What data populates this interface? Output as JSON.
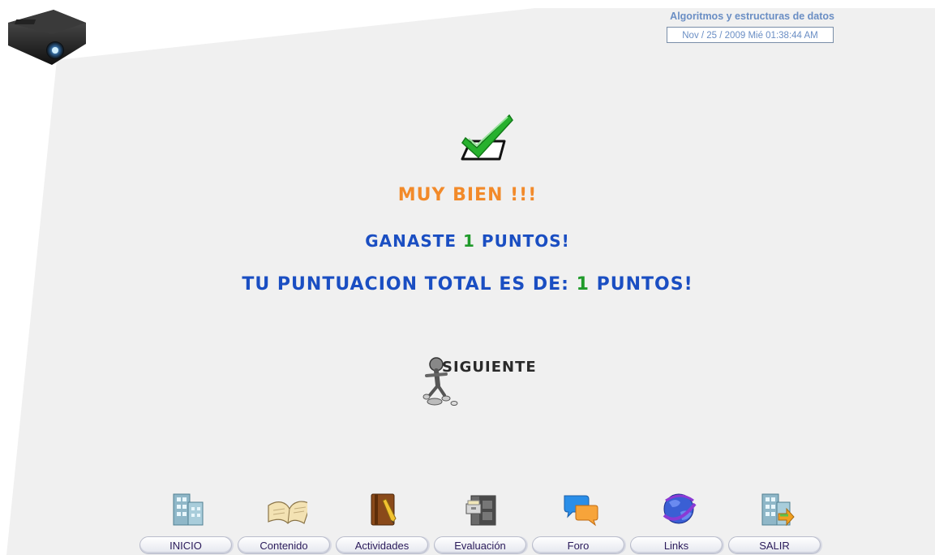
{
  "header": {
    "course_title": "Algoritmos y estructuras de datos",
    "datetime": "Nov / 25 / 2009 Mié 01:38:44 AM",
    "logo_icon": "projector-icon"
  },
  "result": {
    "status_icon": "check-ballot-icon",
    "message": "MUY BIEN !!!",
    "earned_prefix": "GANASTE ",
    "earned_points": "1",
    "earned_suffix": " PUNTOS!",
    "total_prefix": "TU PUNTUACION TOTAL ES DE: ",
    "total_points": "1",
    "total_suffix": " PUNTOS!"
  },
  "next_button": {
    "label": "SIGUIENTE",
    "icon": "stick-figure-icon"
  },
  "nav": {
    "items": [
      {
        "label": "INICIO",
        "icon": "building-icon"
      },
      {
        "label": "Contenido",
        "icon": "open-book-icon"
      },
      {
        "label": "Actividades",
        "icon": "notebook-pencil-icon"
      },
      {
        "label": "Evaluación",
        "icon": "file-cabinet-icon"
      },
      {
        "label": "Foro",
        "icon": "chat-bubbles-icon"
      },
      {
        "label": "Links",
        "icon": "globe-icon"
      },
      {
        "label": "SALIR",
        "icon": "building-exit-icon"
      }
    ]
  },
  "colors": {
    "title_blue": "#6a8ec4",
    "message_orange": "#f28a2a",
    "headline_blue": "#1a4ec2",
    "points_green": "#1f9a2a",
    "panel_gray": "#f0f0f0"
  }
}
